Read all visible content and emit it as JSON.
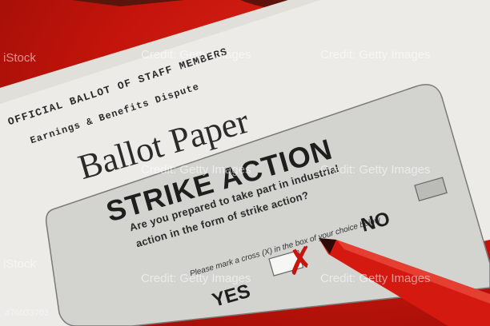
{
  "ballot": {
    "heading_official": "OFFICIAL BALLOT OF STAFF MEMBERS",
    "heading_sub": "Earnings & Benefits Dispute",
    "title": "Ballot Paper",
    "strike_title": "STRIKE ACTION",
    "question_line1": "Are you prepared to take part in industrial",
    "question_line2": "action in the form of strike action?",
    "instruction": "Please mark a cross (X) in the box of your choice below",
    "no_label": "NO",
    "yes_label": "YES",
    "cross": "✗"
  },
  "watermark": {
    "brand": "iStock",
    "credit": "Credit: Getty Images"
  },
  "stock_id": "476033703",
  "colors": {
    "background_red": "#c8140c",
    "paper": "#ecebe7",
    "panel": "#d3d3d0",
    "pen_red": "#d41a10",
    "glasses_tortoise": "#6b1b10"
  }
}
